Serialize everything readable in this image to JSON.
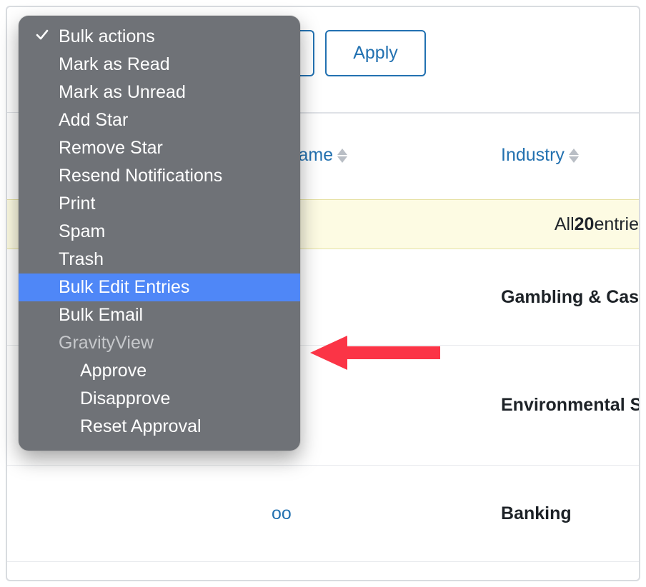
{
  "toolbar": {
    "apply_label": "Apply"
  },
  "dropdown": {
    "items": [
      {
        "label": "Bulk actions",
        "checked": true
      },
      {
        "label": "Mark as Read"
      },
      {
        "label": "Mark as Unread"
      },
      {
        "label": "Add Star"
      },
      {
        "label": "Remove Star"
      },
      {
        "label": "Resend Notifications"
      },
      {
        "label": "Print"
      },
      {
        "label": "Spam"
      },
      {
        "label": "Trash"
      },
      {
        "label": "Bulk Edit Entries",
        "highlight": true
      },
      {
        "label": "Bulk Email"
      },
      {
        "label": "GravityView",
        "group": true
      },
      {
        "label": "Approve",
        "indent": true
      },
      {
        "label": "Disapprove",
        "indent": true
      },
      {
        "label": "Reset Approval",
        "indent": true
      }
    ]
  },
  "table": {
    "columns": {
      "name_fragment": "s Name",
      "industry": "Industry"
    },
    "banner": {
      "prefix": "All ",
      "count": "20",
      "suffix": " entrie"
    },
    "rows": [
      {
        "name_fragment": "",
        "industry": "Gambling & Casi"
      },
      {
        "name_fragment": "",
        "industry": "Environmental S"
      },
      {
        "name_fragment": "oo",
        "industry": "Banking"
      }
    ]
  },
  "annotation": {
    "arrow_color": "#fb3446"
  }
}
